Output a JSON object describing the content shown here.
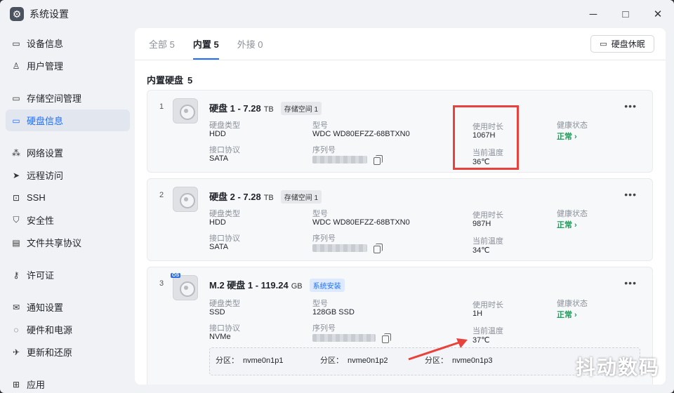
{
  "app": {
    "title": "系统设置"
  },
  "window_controls": {
    "minimize": "─",
    "maximize": "□",
    "close": "✕"
  },
  "sidebar": {
    "items": [
      {
        "label": "设备信息",
        "icon": "device-icon"
      },
      {
        "label": "用户管理",
        "icon": "user-icon"
      },
      {
        "label": "存储空间管理",
        "icon": "storage-icon"
      },
      {
        "label": "硬盘信息",
        "icon": "disk-icon",
        "active": true
      },
      {
        "label": "网络设置",
        "icon": "network-icon"
      },
      {
        "label": "远程访问",
        "icon": "send-icon"
      },
      {
        "label": "SSH",
        "icon": "terminal-icon"
      },
      {
        "label": "安全性",
        "icon": "shield-icon"
      },
      {
        "label": "文件共享协议",
        "icon": "file-icon"
      },
      {
        "label": "许可证",
        "icon": "key-icon"
      },
      {
        "label": "通知设置",
        "icon": "mail-icon"
      },
      {
        "label": "硬件和电源",
        "icon": "power-icon"
      },
      {
        "label": "更新和还原",
        "icon": "rocket-icon"
      },
      {
        "label": "应用",
        "icon": "apps-icon"
      }
    ]
  },
  "tabs": [
    {
      "label": "全部 5"
    },
    {
      "label": "内置 5",
      "active": true
    },
    {
      "label": "外接 0"
    }
  ],
  "sleep_button": "硬盘休眠",
  "section": {
    "title": "内置硬盘",
    "count": "5"
  },
  "labels": {
    "type": "硬盘类型",
    "model": "型号",
    "usage": "使用时长",
    "health": "健康状态",
    "iface": "接口协议",
    "serial": "序列号",
    "temp": "当前温度",
    "partition": "分区："
  },
  "disks": [
    {
      "index": "1",
      "name": "硬盘 1 - 7.28",
      "unit": "TB",
      "tag": "存储空间 1",
      "type": "HDD",
      "model": "WDC WD80EFZZ-68BTXN0",
      "usage": "1067H",
      "health": "正常 ›",
      "iface": "SATA",
      "temp": "36℃"
    },
    {
      "index": "2",
      "name": "硬盘 2 - 7.28",
      "unit": "TB",
      "tag": "存储空间 1",
      "type": "HDD",
      "model": "WDC WD80EFZZ-68BTXN0",
      "usage": "987H",
      "health": "正常 ›",
      "iface": "SATA",
      "temp": "34℃"
    },
    {
      "index": "3",
      "name": "M.2 硬盘 1 - 119.24",
      "unit": "GB",
      "tag": "系统安装",
      "type": "SSD",
      "model": "128GB SSD",
      "usage": "1H",
      "health": "正常 ›",
      "iface": "NVMe",
      "temp": "37℃",
      "os_badge": "OS",
      "partitions": [
        "nvme0n1p1",
        "nvme0n1p2",
        "nvme0n1p3"
      ]
    }
  ],
  "watermark": "抖动数码",
  "colors": {
    "accent": "#1f6fff",
    "health": "#1aa05a",
    "highlight": "#e8423c"
  }
}
